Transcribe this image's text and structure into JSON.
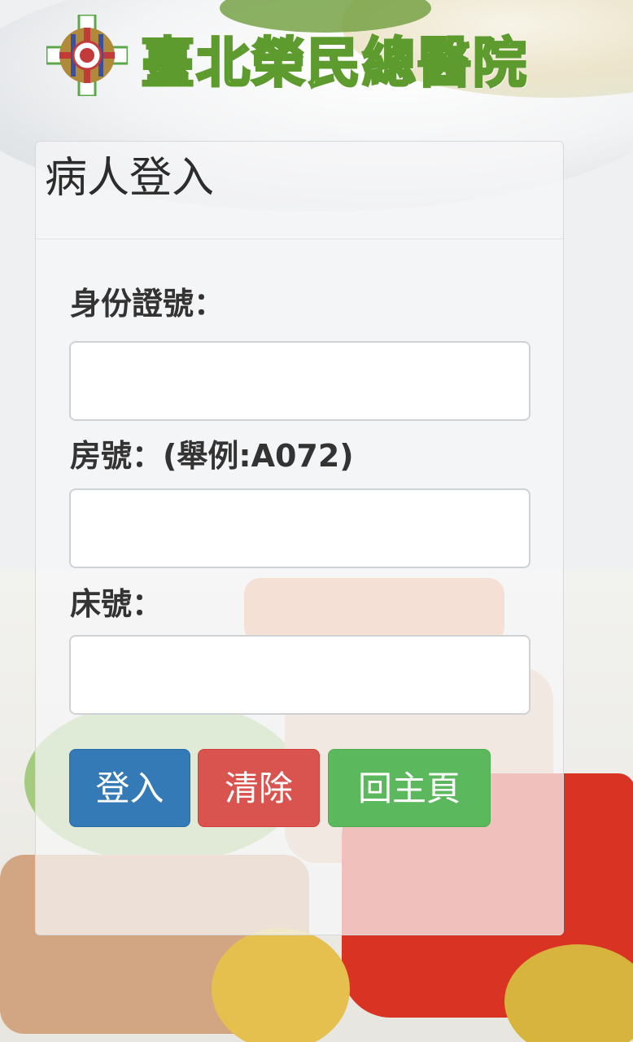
{
  "header": {
    "hospital_name": "臺北榮民總醫院",
    "logo_icon": "hospital-emblem-icon"
  },
  "login": {
    "title": "病人登入",
    "id_label": "身份證號：",
    "id_value": "",
    "room_label": "房號：(舉例:A072)",
    "room_value": "",
    "bed_label": "床號：",
    "bed_value": ""
  },
  "buttons": {
    "login": "登入",
    "clear": "清除",
    "home": "回主頁"
  },
  "colors": {
    "login_button": "#337ab7",
    "clear_button": "#d9534f",
    "home_button": "#5cb85c",
    "brand_text": "#9fe17a"
  }
}
